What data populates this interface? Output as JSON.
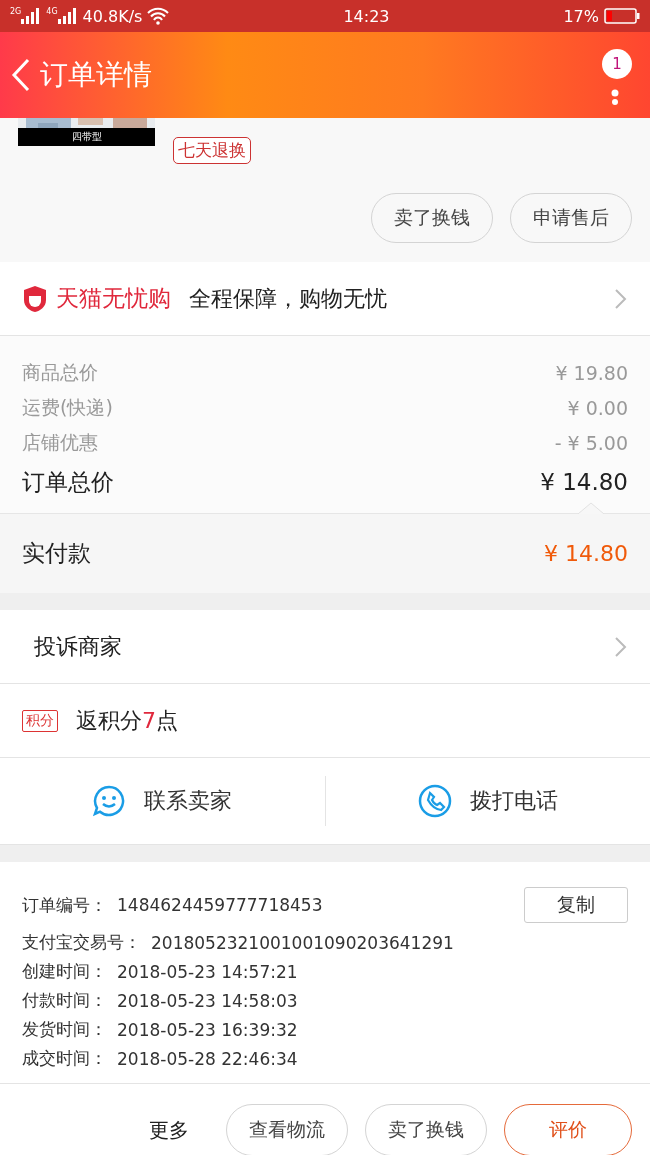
{
  "status_bar": {
    "signal_1": "2G",
    "signal_2": "4G",
    "speed": "40.8K/s",
    "time": "14:23",
    "battery": "17%"
  },
  "header": {
    "title": "订单详情",
    "badge": "1"
  },
  "product": {
    "image": {
      "kind": "picture"
    },
    "image_caption": "四带型",
    "tag": "七天退换",
    "buttons": [
      "卖了换钱",
      "申请售后"
    ]
  },
  "guarantee": {
    "brand": "天猫无忧购",
    "slogan": "全程保障，购物无忧"
  },
  "prices": [
    {
      "label": "商品总价",
      "value": "¥ 19.80",
      "kind": "minor"
    },
    {
      "label": "运费(快递)",
      "value": "¥ 0.00",
      "kind": "minor"
    },
    {
      "label": "店铺优惠",
      "value": "- ¥ 5.00",
      "kind": "minor"
    },
    {
      "label": "订单总价",
      "value": "¥ 14.80",
      "kind": "total"
    }
  ],
  "paid": {
    "label": "实付款",
    "value": "¥ 14.80"
  },
  "complaint": "投诉商家",
  "points": {
    "badge": "积分",
    "prefix": "返积分",
    "count": "7",
    "suffix": "点"
  },
  "contact": [
    {
      "label": "联系卖家",
      "kind": "chat"
    },
    {
      "label": "拨打电话",
      "kind": "phone"
    }
  ],
  "order_info": {
    "rows": [
      {
        "label": "订单编号：",
        "value": "1484624459777718453"
      },
      {
        "label": "支付宝交易号：",
        "value": "2018052321001001090203641291"
      },
      {
        "label": "创建时间：",
        "value": "2018-05-23 14:57:21"
      },
      {
        "label": "付款时间：",
        "value": "2018-05-23 14:58:03"
      },
      {
        "label": "发货时间：",
        "value": "2018-05-23 16:39:32"
      },
      {
        "label": "成交时间：",
        "value": "2018-05-28 22:46:34"
      }
    ],
    "copy_button": "复制"
  },
  "bottom_bar": {
    "more": "更多",
    "buttons": [
      {
        "label": "查看物流",
        "primary": false
      },
      {
        "label": "卖了换钱",
        "primary": false
      },
      {
        "label": "评价",
        "primary": true
      }
    ]
  }
}
